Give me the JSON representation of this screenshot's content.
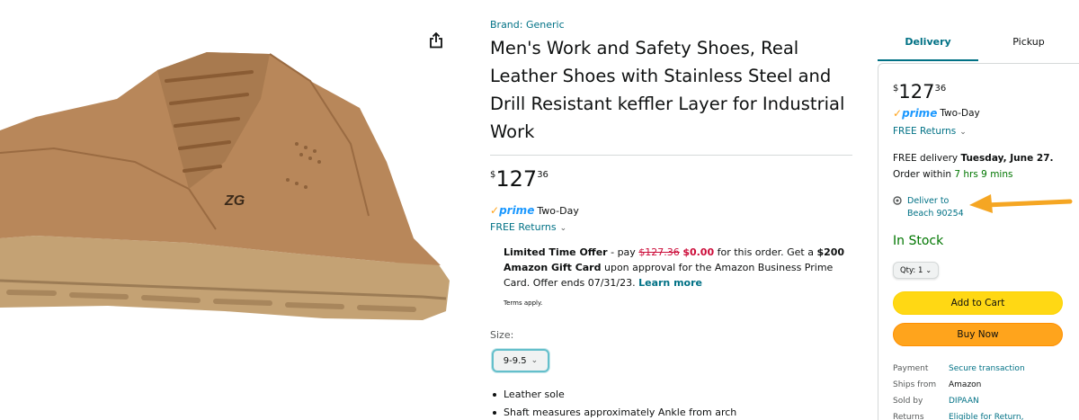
{
  "product": {
    "image_alt": "Tan suede safety work boot",
    "logo_text": "ZG",
    "brand": "Brand: Generic",
    "title": "Men's Work and Safety Shoes, Real Leather Shoes with Stainless Steel and Drill Resistant keffler Layer for Industrial Work",
    "share_icon": "share-icon"
  },
  "price": {
    "symbol": "$",
    "whole": "127",
    "fraction": "36"
  },
  "prime": {
    "check": "✓",
    "label": "prime",
    "speed": "Two-Day"
  },
  "returns": {
    "label": "FREE Returns",
    "chevron": "⌄"
  },
  "offer": {
    "prefix": "Limited Time Offer",
    "pay_text": " - pay ",
    "old_price": "$127.36",
    "new_price": "$0.00",
    "mid_text": " for this order. Get a ",
    "gift": "$200 Amazon Gift Card",
    "suffix": " upon approval for the Amazon Business Prime Card. Offer ends 07/31/23. ",
    "learn_more": "Learn more",
    "terms": "Terms apply."
  },
  "size": {
    "label": "Size:",
    "selected": "9-9.5"
  },
  "bullets": [
    "Leather sole",
    "Shaft measures approximately Ankle from arch"
  ],
  "buybox": {
    "tabs": [
      "Delivery",
      "Pickup"
    ],
    "delivery_line1_prefix": "FREE delivery ",
    "delivery_date": "Tuesday, June 27.",
    "order_within_prefix": "Order within ",
    "order_within_time": "7 hrs 9 mins",
    "deliver_to_line1": "Deliver to",
    "deliver_to_line2": "Beach 90254",
    "stock": "In Stock",
    "qty": "Qty: 1",
    "add_to_cart": "Add to Cart",
    "buy_now": "Buy Now",
    "details": [
      {
        "key": "Payment",
        "value": "Secure transaction"
      },
      {
        "key": "Ships from",
        "value": "Amazon"
      },
      {
        "key": "Sold by",
        "value": "DIPAAN"
      },
      {
        "key": "Returns",
        "value": "Eligible for Return,"
      }
    ]
  },
  "colors": {
    "link": "#007185",
    "prime_blue": "#1a98ff",
    "prime_check": "#ffa41c",
    "in_stock": "#007600",
    "cart_button": "#ffd814",
    "buy_button": "#ffa41c",
    "arrow": "#f5a623",
    "boot": "#b8875a"
  }
}
